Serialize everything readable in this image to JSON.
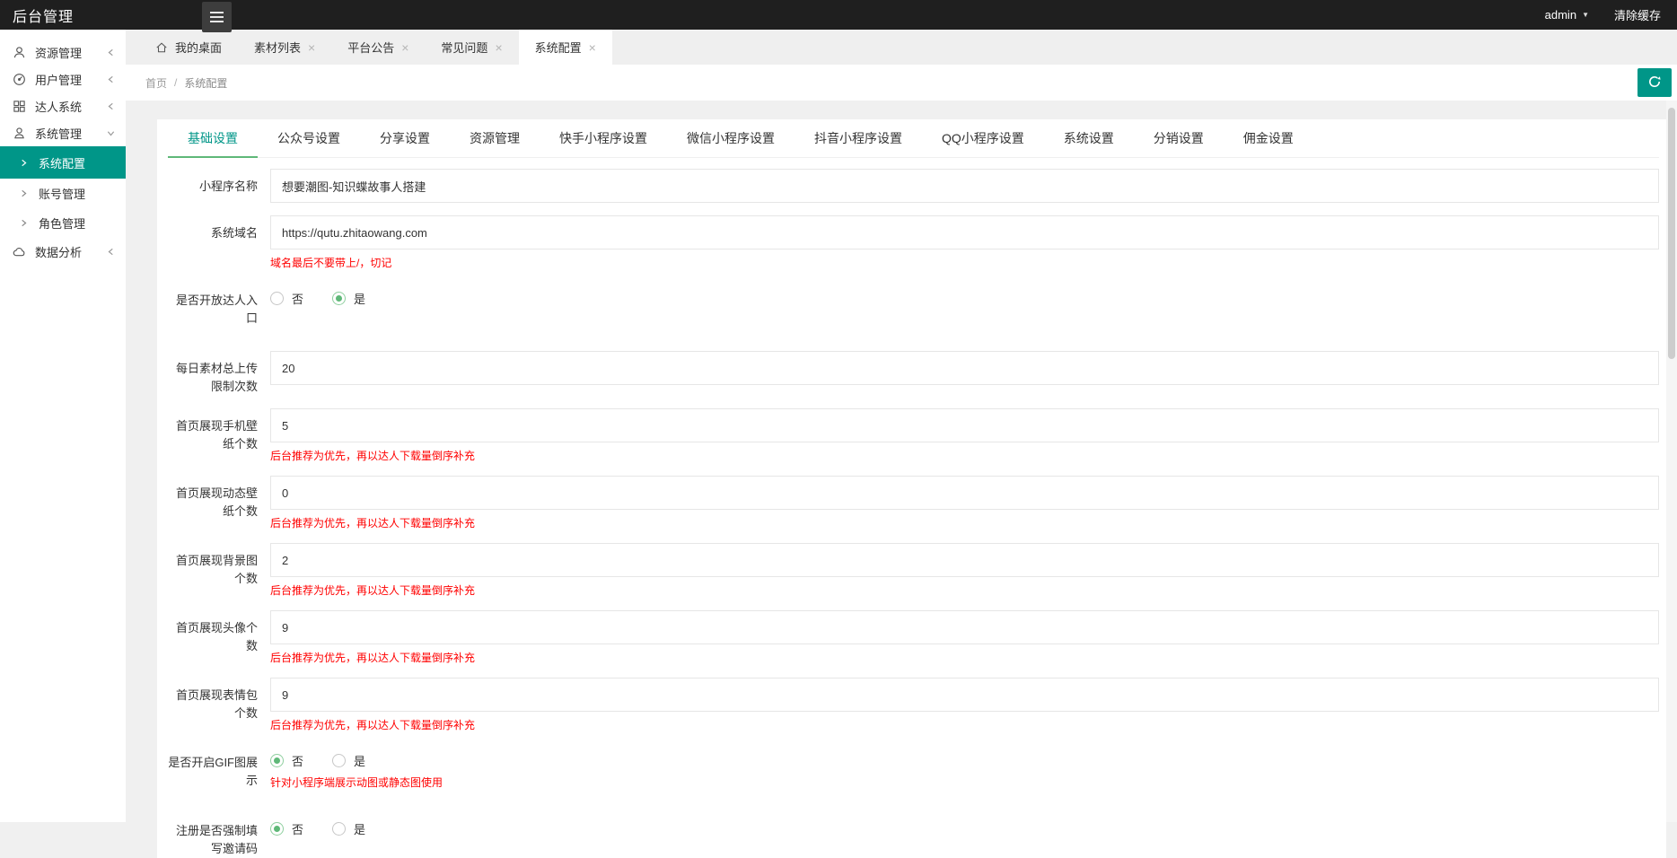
{
  "colors": {
    "primary": "#009688",
    "green": "#5FB878",
    "red": "#ff0000",
    "topbar": "#1f1f1f"
  },
  "topbar": {
    "title": "后台管理",
    "user": "admin",
    "clear_cache": "清除缓存"
  },
  "sidebar": {
    "items": [
      {
        "label": "资源管理",
        "icon": "user-icon",
        "state": "collapsed"
      },
      {
        "label": "用户管理",
        "icon": "dashboard-icon",
        "state": "collapsed"
      },
      {
        "label": "达人系统",
        "icon": "grid-icon",
        "state": "collapsed"
      },
      {
        "label": "系统管理",
        "icon": "admin-user-icon",
        "state": "expanded",
        "children": [
          {
            "label": "系统配置",
            "active": true
          },
          {
            "label": "账号管理",
            "active": false
          },
          {
            "label": "角色管理",
            "active": false
          }
        ]
      },
      {
        "label": "数据分析",
        "icon": "cloud-icon",
        "state": "collapsed"
      }
    ]
  },
  "tabs": [
    {
      "label": "我的桌面",
      "icon": "home-icon",
      "closable": false,
      "active": false
    },
    {
      "label": "素材列表",
      "closable": true,
      "active": false
    },
    {
      "label": "平台公告",
      "closable": true,
      "active": false
    },
    {
      "label": "常见问题",
      "closable": true,
      "active": false
    },
    {
      "label": "系统配置",
      "closable": true,
      "active": true
    }
  ],
  "breadcrumb": {
    "home": "首页",
    "separator": "/",
    "current": "系统配置"
  },
  "setting_tabs": [
    {
      "label": "基础设置",
      "active": true
    },
    {
      "label": "公众号设置",
      "active": false
    },
    {
      "label": "分享设置",
      "active": false
    },
    {
      "label": "资源管理",
      "active": false
    },
    {
      "label": "快手小程序设置",
      "active": false
    },
    {
      "label": "微信小程序设置",
      "active": false
    },
    {
      "label": "抖音小程序设置",
      "active": false
    },
    {
      "label": "QQ小程序设置",
      "active": false
    },
    {
      "label": "系统设置",
      "active": false
    },
    {
      "label": "分销设置",
      "active": false
    },
    {
      "label": "佣金设置",
      "active": false
    }
  ],
  "form": {
    "rows": [
      {
        "type": "text",
        "name": "mini-program-name",
        "label": "小程序名称",
        "value": "想要潮图-知识蝶故事人搭建"
      },
      {
        "type": "text",
        "name": "system-domain",
        "label": "系统域名",
        "value": "https://qutu.zhitaowang.com",
        "hint": "域名最后不要带上/，切记"
      },
      {
        "type": "radio",
        "name": "open-daren-entry",
        "label": "是否开放达人入口",
        "options": [
          "否",
          "是"
        ],
        "selected": 1
      },
      {
        "type": "text",
        "name": "daily-upload-limit",
        "label": "每日素材总上传限制次数",
        "value": "20"
      },
      {
        "type": "text",
        "name": "home-phone-wallpaper-count",
        "label": "首页展现手机壁纸个数",
        "value": "5",
        "hint": "后台推荐为优先，再以达人下载量倒序补充"
      },
      {
        "type": "text",
        "name": "home-live-wallpaper-count",
        "label": "首页展现动态壁纸个数",
        "value": "0",
        "hint": "后台推荐为优先，再以达人下载量倒序补充"
      },
      {
        "type": "text",
        "name": "home-background-count",
        "label": "首页展现背景图个数",
        "value": "2",
        "hint": "后台推荐为优先，再以达人下载量倒序补充"
      },
      {
        "type": "text",
        "name": "home-avatar-count",
        "label": "首页展现头像个数",
        "value": "9",
        "hint": "后台推荐为优先，再以达人下载量倒序补充"
      },
      {
        "type": "text",
        "name": "home-emoji-count",
        "label": "首页展现表情包个数",
        "value": "9",
        "hint": "后台推荐为优先，再以达人下载量倒序补充"
      },
      {
        "type": "radio",
        "name": "enable-gif-display",
        "label": "是否开启GIF图展示",
        "options": [
          "否",
          "是"
        ],
        "selected": 0,
        "hint": "针对小程序端展示动图或静态图使用"
      },
      {
        "type": "radio",
        "name": "register-force-invite-code",
        "label": "注册是否强制填写邀请码",
        "options": [
          "否",
          "是"
        ],
        "selected": 0
      }
    ]
  }
}
